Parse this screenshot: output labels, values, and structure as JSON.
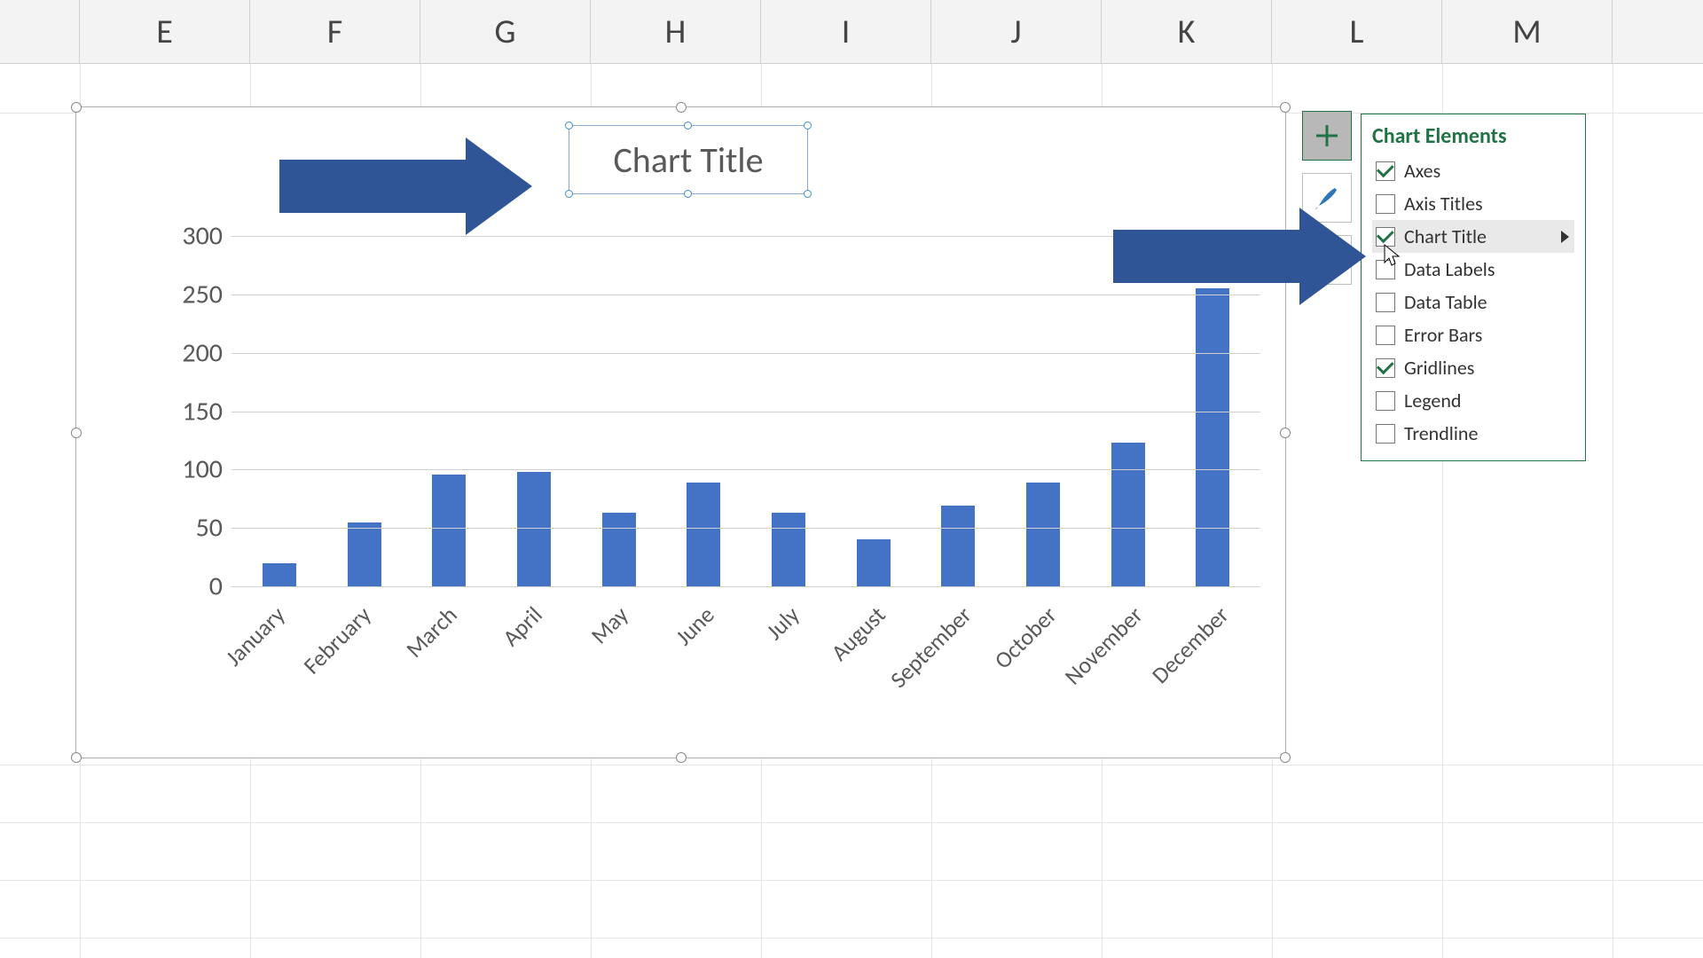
{
  "columns": [
    "E",
    "F",
    "G",
    "H",
    "I",
    "J",
    "K",
    "L",
    "M"
  ],
  "chart_title": "Chart Title",
  "chart_elements_button_icon": "plus-icon",
  "style_button_icon": "brush-icon",
  "filter_button_icon": "funnel-icon",
  "flyout": {
    "title": "Chart Elements",
    "items": [
      {
        "label": "Axes",
        "checked": true,
        "hover": false
      },
      {
        "label": "Axis Titles",
        "checked": false,
        "hover": false
      },
      {
        "label": "Chart Title",
        "checked": true,
        "hover": true
      },
      {
        "label": "Data Labels",
        "checked": false,
        "hover": false
      },
      {
        "label": "Data Table",
        "checked": false,
        "hover": false
      },
      {
        "label": "Error Bars",
        "checked": false,
        "hover": false
      },
      {
        "label": "Gridlines",
        "checked": true,
        "hover": false
      },
      {
        "label": "Legend",
        "checked": false,
        "hover": false
      },
      {
        "label": "Trendline",
        "checked": false,
        "hover": false
      }
    ]
  },
  "chart_data": {
    "type": "bar",
    "title": "Chart Title",
    "xlabel": "",
    "ylabel": "",
    "ylim": [
      0,
      300
    ],
    "yticks": [
      0,
      50,
      100,
      150,
      200,
      250,
      300
    ],
    "categories": [
      "January",
      "February",
      "March",
      "April",
      "May",
      "June",
      "July",
      "August",
      "September",
      "October",
      "November",
      "December"
    ],
    "values": [
      20,
      55,
      96,
      98,
      63,
      89,
      63,
      40,
      69,
      89,
      123,
      255
    ],
    "series_color": "#4472c4"
  }
}
